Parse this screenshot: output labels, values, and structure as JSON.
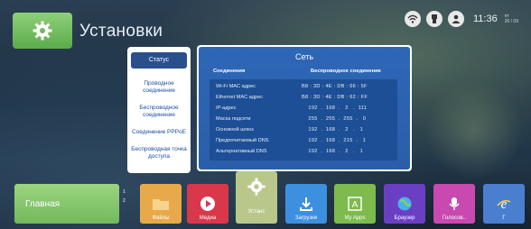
{
  "header": {
    "title": "Установки",
    "app_icon": "gear-icon",
    "time": "11:36",
    "date_top": "пт",
    "date_bottom": "26 / 09"
  },
  "status_icons": [
    "wifi-icon",
    "usb-icon",
    "account-icon"
  ],
  "menu": {
    "items": [
      {
        "label": "Статус",
        "active": true
      },
      {
        "label": "Проводное соединение",
        "active": false
      },
      {
        "label": "Беспроводное соединение",
        "active": false
      },
      {
        "label": "Соединение PPPoE",
        "active": false
      },
      {
        "label": "Беспроводная точка доступа",
        "active": false
      }
    ]
  },
  "panel": {
    "title": "Сеть",
    "col_left": "Соединения",
    "col_right": "Беспроводное соединение",
    "rows": [
      {
        "k": "Wi-Fi MAC адрес",
        "v": "B8 : 3D : 4E : DB : 66 : 5F"
      },
      {
        "k": "Ethernet MAC адрес",
        "v": "B8 : 3D : 4E : DB : 62 : FF"
      },
      {
        "k": "IP-адрес",
        "v": "    192  .  168  .   2   .  111"
      },
      {
        "k": "Маска подсети",
        "v": "    255  .  255  .  255  .   0"
      },
      {
        "k": "Основной шлюз",
        "v": "    192  .  168  .   2   .   1"
      },
      {
        "k": "Предпочитаемый DNS",
        "v": "    192  .  168  .  215  .   1"
      },
      {
        "k": "Альтернативный DNS",
        "v": "    192  .  168  .   2   .   1"
      }
    ]
  },
  "dock": {
    "home_label": "Главная",
    "badge_top": "1",
    "badge_bottom": "2",
    "focus_label": "Устанс",
    "tiles": [
      {
        "label": "Файлы",
        "color": "#e8a94a",
        "icon": "folder-icon"
      },
      {
        "label": "Медиа",
        "color": "#d8384a",
        "icon": "play-icon"
      },
      {
        "label": "Загрузки",
        "color": "#3d8fe0",
        "icon": "download-icon"
      },
      {
        "label": "My Apps",
        "color": "#7dbb4c",
        "icon": "apps-icon"
      },
      {
        "label": "Браузер",
        "color": "#6b3fc4",
        "icon": "globe-icon"
      },
      {
        "label": "Голосов..",
        "color": "#c84ab0",
        "icon": "microphone-icon"
      },
      {
        "label": "Г",
        "color": "#4a7fd0",
        "icon": "internet-explorer-icon"
      }
    ]
  }
}
